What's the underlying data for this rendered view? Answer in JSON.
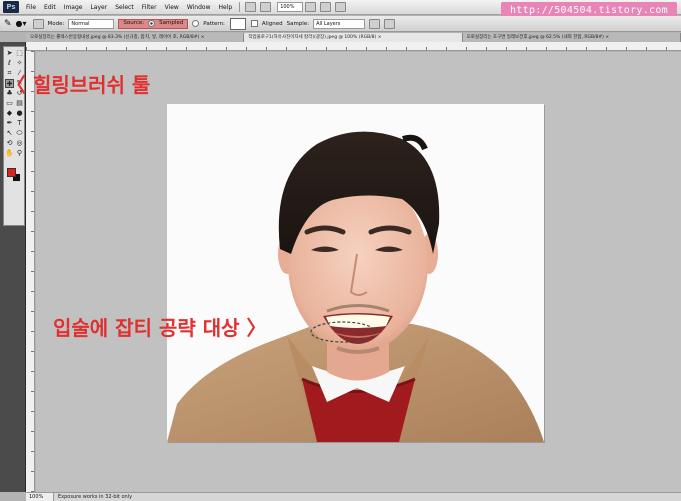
{
  "blog_watermark": "http://504504.tistory.com",
  "menubar": {
    "logo": "Ps",
    "items": [
      "File",
      "Edit",
      "Image",
      "Layer",
      "Select",
      "Filter",
      "View",
      "Window",
      "Help"
    ],
    "zoom": "100%"
  },
  "options": {
    "mode_label": "Mode:",
    "mode_value": "Normal",
    "source_label": "Source:",
    "source_sampled": "Sampled",
    "source_pattern": "Pattern:",
    "aligned_label": "Aligned",
    "sample_label": "Sample:",
    "sample_value": "All Layers"
  },
  "tabs": [
    {
      "label": "오로실장리는 롤렉스반응형내성.jpeg @ 83.3% (신규층, 합치, 넣, 레이어 포, RGB/8#) ×",
      "active": false
    },
    {
      "label": "작업물로구1(자유사진이자세 칼라)(광장).jpeg @ 100% (RGB/8) ×",
      "active": true
    },
    {
      "label": "오로실장리는 초구면 일레보전후.jpeg @ 62.5% (내외 한합, RGB/8#) ×",
      "active": false
    }
  ],
  "statusbar": {
    "zoom": "100%",
    "text": "Exposure works in 32-bit only"
  },
  "annotations": {
    "tool": "〈 힐링브러쉬 툴",
    "lips": "입술에 잡티 공략 대상 〉"
  },
  "colors": {
    "foreground": "#e0201c",
    "background": "#111111",
    "annotation": "#e03030",
    "watermark_bg": "#e884b6"
  }
}
